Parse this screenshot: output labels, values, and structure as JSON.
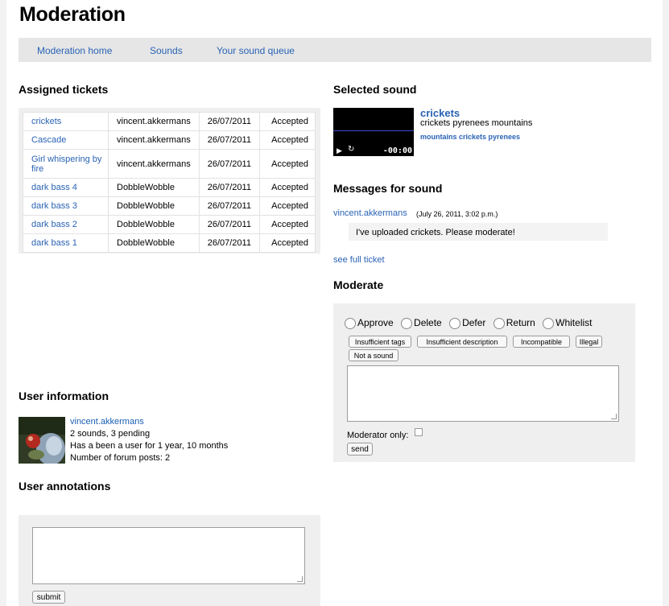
{
  "page_title": "Moderation",
  "nav": [
    "Moderation home",
    "Sounds",
    "Your sound queue"
  ],
  "assigned_tickets": {
    "title": "Assigned tickets",
    "rows": [
      {
        "sound": "crickets",
        "user": "vincent.akkermans",
        "date": "26/07/2011",
        "status": "Accepted"
      },
      {
        "sound": "Cascade",
        "user": "vincent.akkermans",
        "date": "26/07/2011",
        "status": "Accepted"
      },
      {
        "sound": "Girl whispering by fire",
        "user": "vincent.akkermans",
        "date": "26/07/2011",
        "status": "Accepted"
      },
      {
        "sound": "dark bass 4",
        "user": "DobbleWobble",
        "date": "26/07/2011",
        "status": "Accepted"
      },
      {
        "sound": "dark bass 3",
        "user": "DobbleWobble",
        "date": "26/07/2011",
        "status": "Accepted"
      },
      {
        "sound": "dark bass 2",
        "user": "DobbleWobble",
        "date": "26/07/2011",
        "status": "Accepted"
      },
      {
        "sound": "dark bass 1",
        "user": "DobbleWobble",
        "date": "26/07/2011",
        "status": "Accepted"
      }
    ]
  },
  "selected_sound": {
    "title": "Selected sound",
    "name": "crickets",
    "description": "crickets pyrenees mountains",
    "tags": "mountains crickets pyrenees",
    "player_time": "-00:00"
  },
  "messages": {
    "title": "Messages for sound",
    "user": "vincent.akkermans",
    "date": "(July 26, 2011, 3:02 p.m.)",
    "text": "I've uploaded crickets. Please moderate!",
    "full_ticket_link": "see full ticket"
  },
  "moderate": {
    "title": "Moderate",
    "options": [
      "Approve",
      "Delete",
      "Defer",
      "Return",
      "Whitelist"
    ],
    "chips": [
      "Insufficient tags",
      "Insufficient description",
      "Incompatible",
      "Illegal",
      "Not a sound"
    ],
    "moderator_only_label": "Moderator only:",
    "send_label": "send"
  },
  "user_information": {
    "title": "User information",
    "username": "vincent.akkermans",
    "sounds": "2 sounds, 3 pending",
    "membership": "Has a been a user for 1 year, 10 months",
    "forum_posts": "Number of forum posts: 2"
  },
  "user_annotations": {
    "title": "User annotations",
    "submit_label": "submit"
  }
}
